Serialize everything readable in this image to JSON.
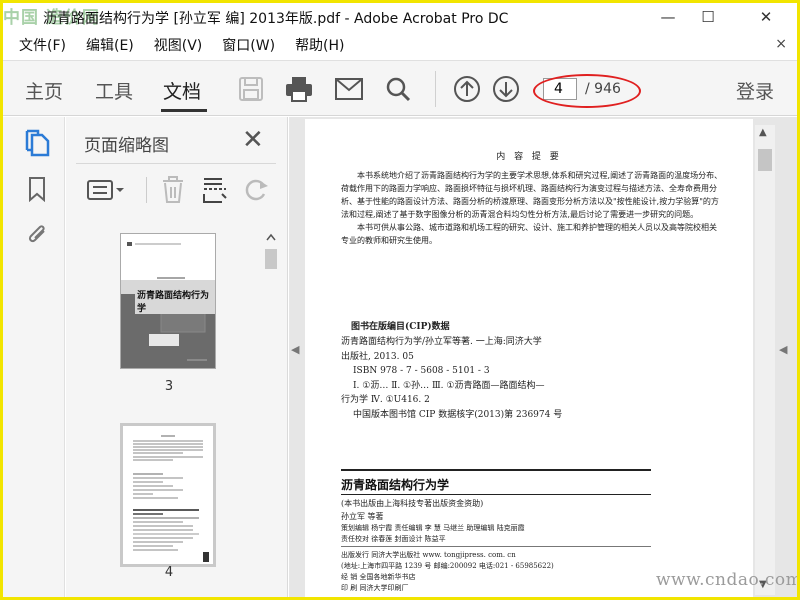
{
  "window": {
    "watermark_logo": "中国 造价网",
    "title": "沥青路面结构行为学 [孙立军 编] 2013年版.pdf - Adobe Acrobat Pro DC",
    "minimize": "—",
    "maximize": "☐",
    "close": "✕"
  },
  "menu": {
    "items": [
      "文件(F)",
      "编辑(E)",
      "视图(V)",
      "窗口(W)",
      "帮助(H)"
    ],
    "close": "×"
  },
  "toolbar": {
    "tabs": {
      "home": "主页",
      "tools": "工具",
      "document": "文档"
    },
    "current_page": "4",
    "total_pages": "/ 946",
    "login": "登录"
  },
  "thumbnails_panel": {
    "title": "页面缩略图",
    "close": "✕",
    "pages": [
      {
        "label": "3",
        "cover_title": "沥青路面结构行为学"
      },
      {
        "label": "4"
      }
    ]
  },
  "document": {
    "heading": "内 容 提 要",
    "abstract": [
      "本书系统地介绍了沥青路面结构行为学的主要学术思想,体系和研究过程,阐述了沥青路面的温度场分布、荷载作用下的路面力学响应、路面损坏特征与损坏机理、路面结构行为演变过程与描述方法、全寿命费用分析、基于性能的路面设计方法、路面分析的桥渡原理、路面变形分析方法以及\"按性能设计,按力学验算\"的方法和过程,阐述了基于数字图像分析的沥青混合料均匀性分析方法,最后讨论了需要进一步研究的问题。",
      "本书可供从事公路、城市道路和机场工程的研究、设计、施工和养护管理的相关人员以及高等院校相关专业的教师和研究生使用。"
    ],
    "cip_title": "图书在版编目(CIP)数据",
    "cip_lines": [
      "沥青路面结构行为学/孙立军等著. 一上海:同济大学",
      "出版社, 2013. 05",
      "ISBN 978 - 7 - 5608 - 5101 - 3",
      "Ⅰ. ①沥…   Ⅱ. ①孙…   Ⅲ. ①沥青路面—路面结构—",
      "行为学   Ⅳ. ①U416. 2",
      "中国版本图书馆 CIP 数据核字(2013)第 236974 号"
    ],
    "book_title": "沥青路面结构行为学",
    "subsidy": "(本书出版由上海科技专著出版资金资助)",
    "author": "孙立军    等著",
    "editors": [
      "策划编辑  杨宁霞      责任编辑  李  慧  马继兰      助理编辑  陆克丽霞",
      "责任校对  徐春莲      封面设计  陈益平"
    ],
    "publish": [
      "出版发行   同济大学出版社        www. tongjipress. com. cn",
      "           (地址:上海市四平路 1239 号    邮编:200092    电话:021 - 65985622)",
      "经    销   全国各地新华书店",
      "印    刷   同济大学印刷厂"
    ]
  },
  "site_watermark": "www.cndao.com",
  "colors": {
    "frame": "#f2e500",
    "annotation_oval": "#e02020",
    "pages_icon": "#2b7bd6"
  }
}
